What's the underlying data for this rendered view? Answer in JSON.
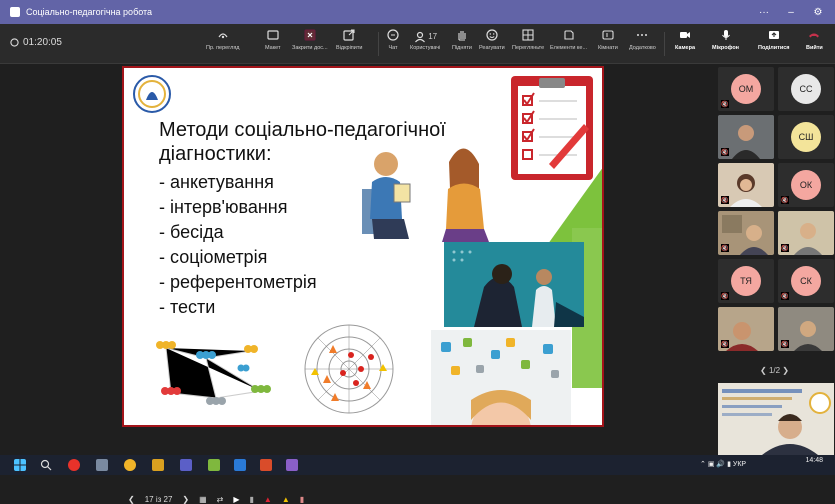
{
  "window": {
    "title": "Соціально-педагогічна робота",
    "more": "···",
    "minimize": "–",
    "close": "⚙"
  },
  "toolbar": {
    "timer": "01:20:05",
    "items": [
      {
        "label": "Пр. перегляд",
        "icon": "focus-icon"
      },
      {
        "label": "Макет",
        "icon": "layout-icon"
      },
      {
        "label": "Закрити дос...",
        "icon": "stop-share-icon"
      },
      {
        "label": "Відкріпити",
        "icon": "pop-out-icon"
      },
      {
        "label": "Чат",
        "icon": "chat-icon"
      },
      {
        "label": "Користувачі",
        "icon": "people-icon",
        "count": "17"
      },
      {
        "label": "Підняти",
        "icon": "raise-hand-icon"
      },
      {
        "label": "Реагувати",
        "icon": "react-icon"
      },
      {
        "label": "Перегляньте",
        "icon": "view-icon"
      },
      {
        "label": "Елементи ке...",
        "icon": "apps-icon"
      },
      {
        "label": "Кімнати",
        "icon": "rooms-icon"
      },
      {
        "label": "Додатково",
        "icon": "more-icon"
      },
      {
        "label": "Камера",
        "icon": "camera-icon"
      },
      {
        "label": "Мікрофон",
        "icon": "mic-icon"
      },
      {
        "label": "Поділитися",
        "icon": "share-icon"
      },
      {
        "label": "Вийти",
        "icon": "hangup-icon"
      }
    ]
  },
  "slide": {
    "title": "Методи соціально-педагогічної діагностики:",
    "items": [
      "- анкетування",
      "- інтерв'ювання",
      "- бесіда",
      "- соціометрія",
      "- референтометрія",
      "- тести"
    ]
  },
  "pager": {
    "page": "17 із 27"
  },
  "participants": [
    {
      "initials": "ОМ",
      "color": "#f4a7a0"
    },
    {
      "initials": "СС",
      "color": "#e8e8e8"
    },
    {
      "initials": "СШ",
      "color": "#f3e49a"
    },
    {
      "initials": "ОК",
      "color": "#f4a7a0"
    },
    {
      "initials": "ТЯ",
      "color": "#f4a7a0"
    },
    {
      "initials": "СК",
      "color": "#f4a7a0"
    }
  ],
  "gallery_page": "1/2",
  "taskbar": {
    "lang": "УКР",
    "time": "14:48"
  },
  "colors": {
    "accent": "#6264a7",
    "slide_border": "#a3141a",
    "slide_green": "#7dc23d",
    "hangup": "#c4314b"
  }
}
